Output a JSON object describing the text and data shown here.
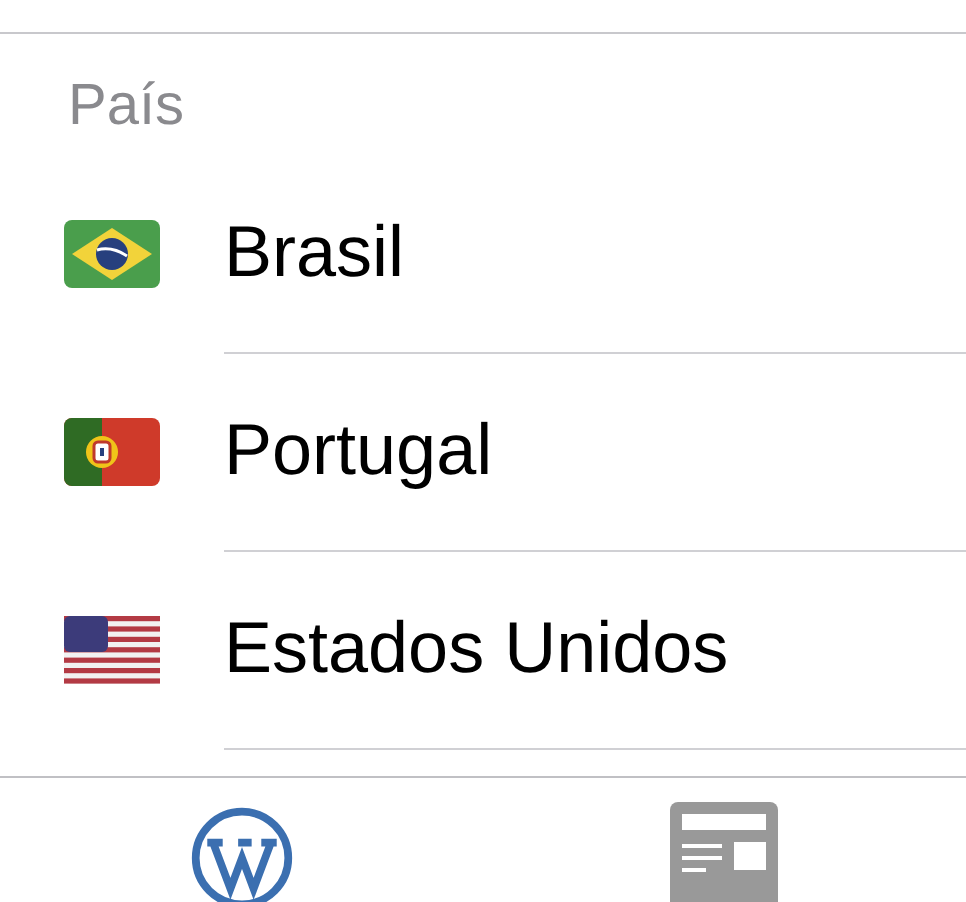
{
  "section": {
    "header": "País"
  },
  "countries": [
    {
      "kind": "br",
      "name": "Brasil"
    },
    {
      "kind": "pt",
      "name": "Portugal"
    },
    {
      "kind": "us",
      "name": "Estados Unidos"
    }
  ],
  "tab_bar": [
    {
      "kind": "wordpress",
      "selected": true
    },
    {
      "kind": "news",
      "selected": false
    }
  ]
}
